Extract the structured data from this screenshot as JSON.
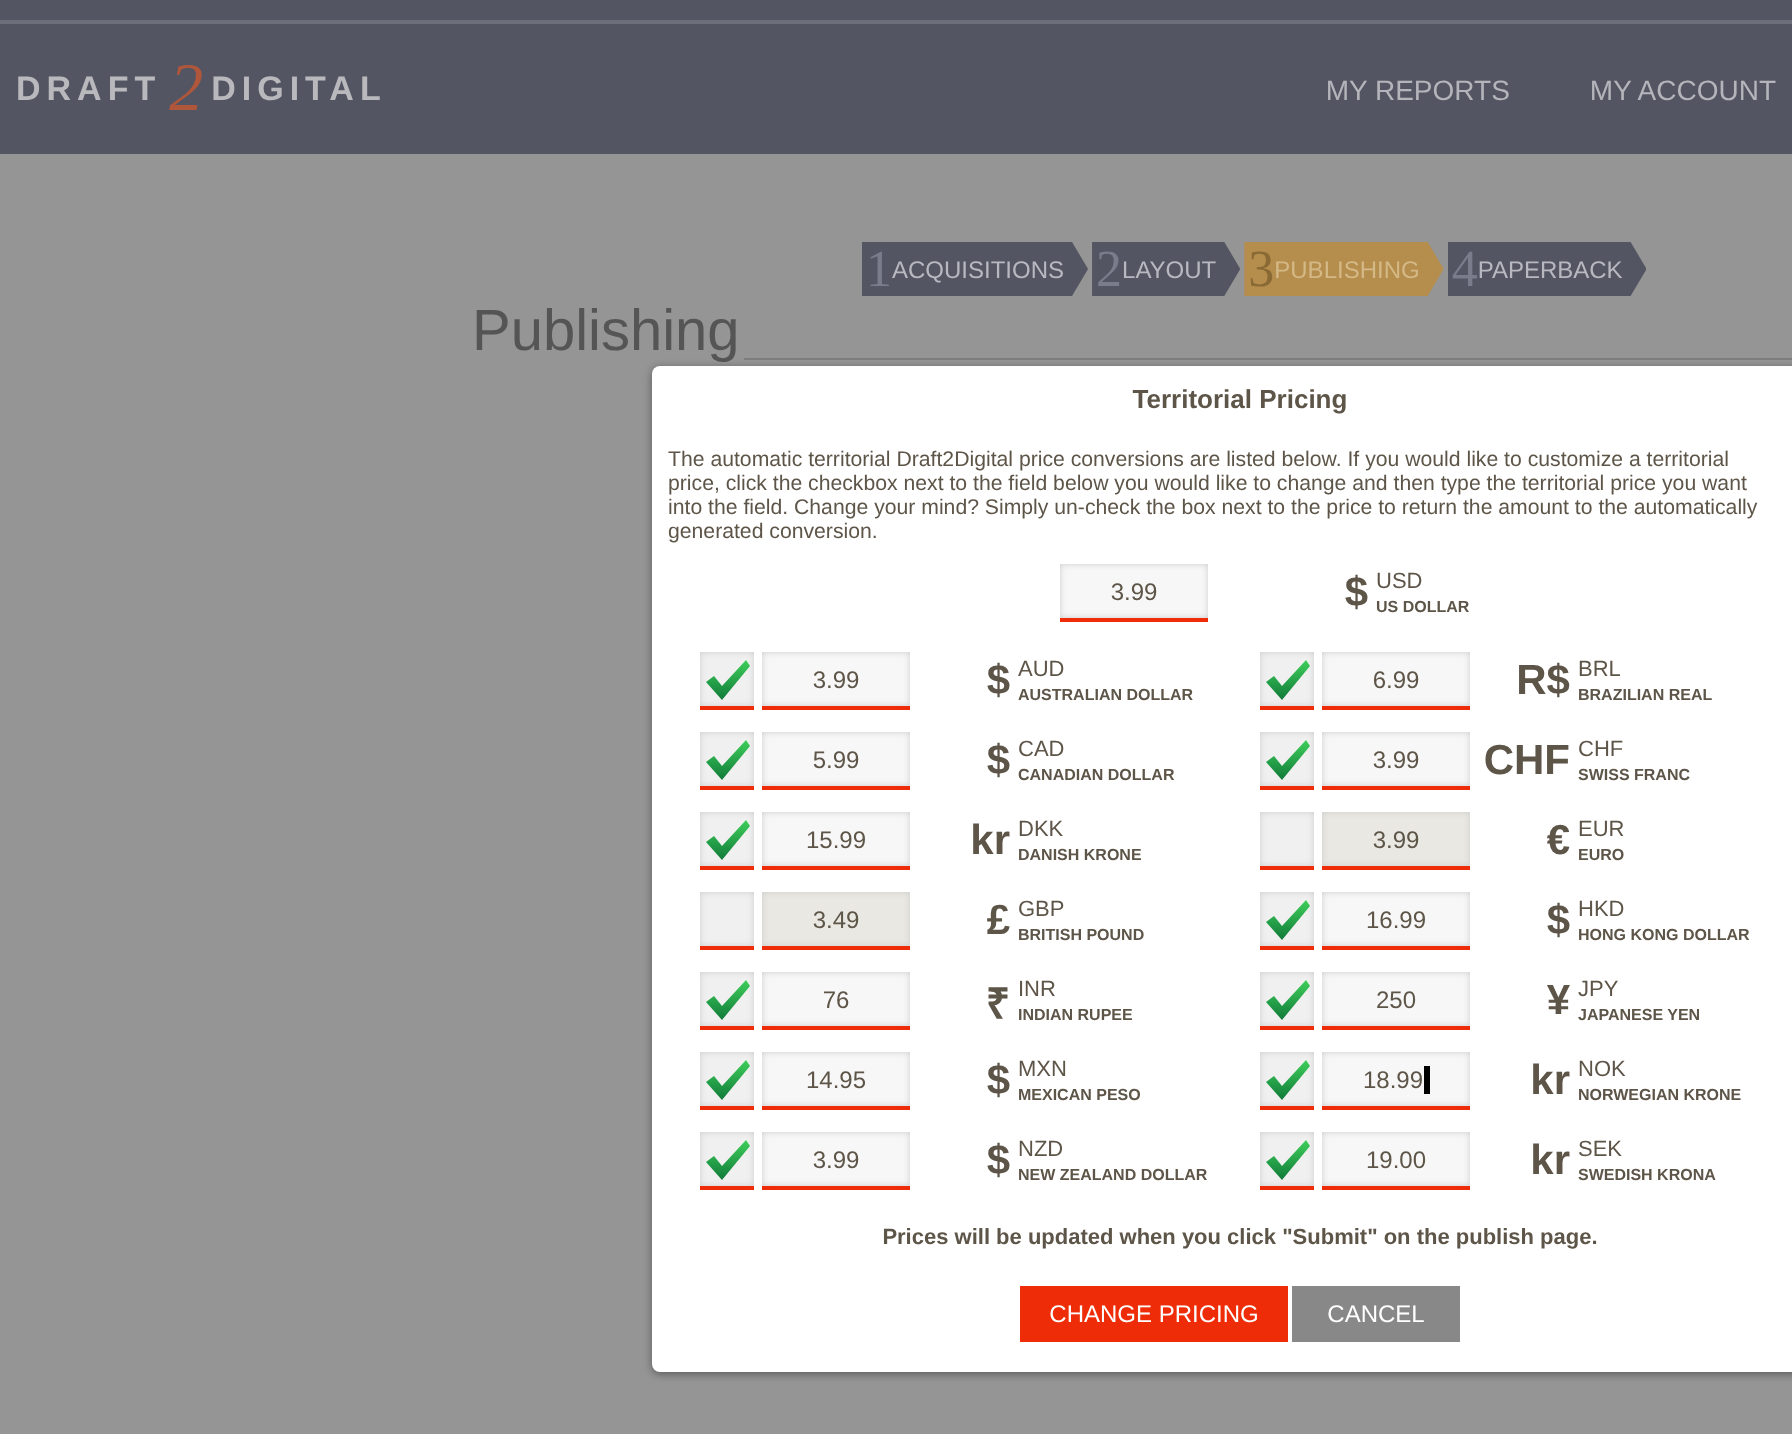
{
  "header": {
    "logo": {
      "left": "DRAFT",
      "mark": "2",
      "right": "DIGITAL"
    },
    "nav": [
      "MY REPORTS",
      "MY ACCOUNT"
    ]
  },
  "steps": [
    {
      "number": "1",
      "label": "ACQUISITIONS",
      "selected": false
    },
    {
      "number": "2",
      "label": "LAYOUT",
      "selected": false
    },
    {
      "number": "3",
      "label": "PUBLISHING",
      "selected": true
    },
    {
      "number": "4",
      "label": "PAPERBACK",
      "selected": false
    }
  ],
  "page_title": "Publishing",
  "dialog": {
    "title": "Territorial Pricing",
    "intro": "The automatic territorial Draft2Digital price conversions are listed below. If you would like to customize a territorial price, click the checkbox next to the field below you would like to change and then type the territorial price you want into the field. Change your mind? Simply un-check the box next to the price to return the amount to the automatically generated conversion.",
    "base": {
      "value": "3.99",
      "symbol": "$",
      "code": "USD",
      "name": "US DOLLAR"
    },
    "prices": [
      {
        "checked": true,
        "value": "3.99",
        "symbol": "$",
        "code": "AUD",
        "name": "AUSTRALIAN DOLLAR",
        "focused": false
      },
      {
        "checked": true,
        "value": "6.99",
        "symbol": "R$",
        "code": "BRL",
        "name": "BRAZILIAN REAL",
        "focused": false
      },
      {
        "checked": true,
        "value": "5.99",
        "symbol": "$",
        "code": "CAD",
        "name": "CANADIAN DOLLAR",
        "focused": false
      },
      {
        "checked": true,
        "value": "3.99",
        "symbol": "CHF",
        "code": "CHF",
        "name": "SWISS FRANC",
        "focused": false
      },
      {
        "checked": true,
        "value": "15.99",
        "symbol": "kr",
        "code": "DKK",
        "name": "DANISH KRONE",
        "focused": false
      },
      {
        "checked": false,
        "value": "3.99",
        "symbol": "€",
        "code": "EUR",
        "name": "EURO",
        "focused": false
      },
      {
        "checked": false,
        "value": "3.49",
        "symbol": "£",
        "code": "GBP",
        "name": "BRITISH POUND",
        "focused": false
      },
      {
        "checked": true,
        "value": "16.99",
        "symbol": "$",
        "code": "HKD",
        "name": "HONG KONG DOLLAR",
        "focused": false
      },
      {
        "checked": true,
        "value": "76",
        "symbol": "₹",
        "code": "INR",
        "name": "INDIAN RUPEE",
        "focused": false
      },
      {
        "checked": true,
        "value": "250",
        "symbol": "¥",
        "code": "JPY",
        "name": "JAPANESE YEN",
        "focused": false
      },
      {
        "checked": true,
        "value": "14.95",
        "symbol": "$",
        "code": "MXN",
        "name": "MEXICAN PESO",
        "focused": false
      },
      {
        "checked": true,
        "value": "18.99",
        "symbol": "kr",
        "code": "NOK",
        "name": "NORWEGIAN KRONE",
        "focused": true
      },
      {
        "checked": true,
        "value": "3.99",
        "symbol": "$",
        "code": "NZD",
        "name": "NEW ZEALAND DOLLAR",
        "focused": false
      },
      {
        "checked": true,
        "value": "19.00",
        "symbol": "kr",
        "code": "SEK",
        "name": "SWEDISH KRONA",
        "focused": false
      }
    ],
    "note": "Prices will be updated when you click \"Submit\" on the publish page.",
    "buttons": [
      {
        "kind": "primary",
        "label": "CHANGE PRICING"
      },
      {
        "kind": "secondary",
        "label": "CANCEL"
      }
    ]
  }
}
